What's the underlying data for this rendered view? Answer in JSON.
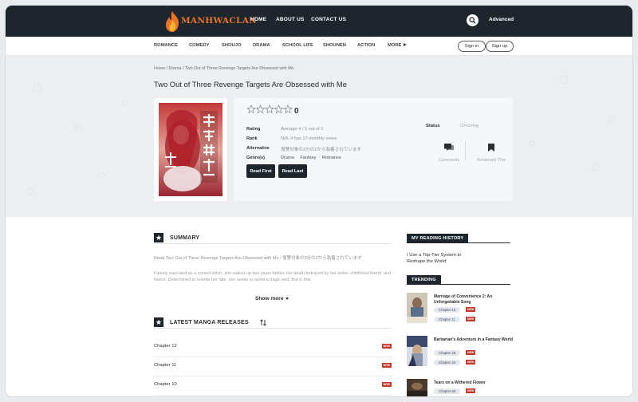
{
  "brand": {
    "logo_text": "MANHWACLAN",
    "accent": "#e8742a"
  },
  "topnav": {
    "links": [
      "HOME",
      "ABOUT US",
      "CONTACT US"
    ],
    "advanced": "Advanced"
  },
  "genres": [
    "ROMANCE",
    "COMEDY",
    "SHOUJO",
    "DRAMA",
    "SCHOOL LIFE",
    "SHOUNEN",
    "ACTION",
    "MORE"
  ],
  "auth": {
    "sign_in": "Sign in",
    "sign_up": "Sign up"
  },
  "breadcrumb": {
    "home": "Home",
    "sep": "/",
    "category": "Drama",
    "current": "Two Out of Three Revenge Targets Are Obsessed with Me"
  },
  "manga": {
    "title": "Two Out of Three Revenge Targets Are Obsessed with Me",
    "stars": 0,
    "rating_number": "0",
    "rows": {
      "rating_label": "Rating",
      "rating_value": "Average 4 / 5 out of 1",
      "rank_label": "Rank",
      "rank_value": "N/A, it has 17 monthly views",
      "alt_label": "Alternative",
      "alt_value": "復讐対象の3分の2から執着されています",
      "genre_label": "Genre(s)",
      "genre_values": [
        "Drama",
        "Fantasy",
        "Romance"
      ]
    },
    "read_first": "Read First",
    "read_last": "Read Last",
    "status_label": "Status",
    "status_value": "OnGoing",
    "comments": "Comments",
    "bookmark": "Bookmark This"
  },
  "summary": {
    "heading": "SUMMARY",
    "p1": "Read Two Out of Three Revenge Targets Are Obsessed with Me / 復讐対象の3分の2から執着されています",
    "p2": "Falsely executed as a cursed witch, she wakes up two years before her death betrayed by her sister, childhood friend, and fiancé. Determined to rewrite her fate, she seeks to avoid a tragic end. But in this",
    "show_more": "Show more"
  },
  "releases": {
    "heading": "LATEST MANGA RELEASES",
    "chapters": [
      {
        "name": "Chapter 12",
        "badge": "NEW"
      },
      {
        "name": "Chapter 11",
        "badge": "NEW"
      },
      {
        "name": "Chapter 10",
        "badge": "NEW"
      }
    ]
  },
  "sidebar": {
    "history_heading": "MY READING HISTORY",
    "history_item": "I Use a Top-Tier System to Reshape the World",
    "trending_heading": "TRENDING",
    "trending": [
      {
        "title": "Marriage of Convenience 2: An Unforgettable Song",
        "chapters": [
          "Chapter 15",
          "Chapter 11"
        ],
        "badge": "NEW"
      },
      {
        "title": "Barbarian's Adventure in a Fantasy World",
        "chapters": [
          "Chapter 25",
          "Chapter 24"
        ],
        "badge": "NEW"
      },
      {
        "title": "Tears on a Withered Flower",
        "chapters": [
          "Chapter 60"
        ],
        "badge": "NEW"
      }
    ]
  }
}
